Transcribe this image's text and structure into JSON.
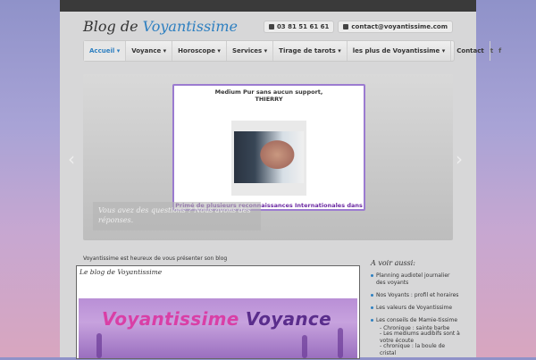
{
  "header": {
    "title_plain": "Blog de ",
    "title_accent": "Voyantissime",
    "phone": "03 81 51 61 61",
    "email": "contact@voyantissime.com"
  },
  "nav": {
    "items": [
      {
        "label": "Accueil",
        "caret": "▾"
      },
      {
        "label": "Voyance",
        "caret": "▾"
      },
      {
        "label": "Horoscope",
        "caret": "▾"
      },
      {
        "label": "Services",
        "caret": "▾"
      },
      {
        "label": "Tirage de tarots",
        "caret": "▾"
      },
      {
        "label": "les plus de Voyantissime",
        "caret": "▾"
      },
      {
        "label": "Contact",
        "caret": ""
      }
    ],
    "social": [
      "twitter-icon",
      "facebook-icon"
    ]
  },
  "slider": {
    "popup_line1": "Medium Pur sans aucun support,",
    "popup_line2": "THIERRY",
    "popup_prize": "Primé de plusieurs reconnaissances Internationales dans le domaine",
    "caption": "Vous avez des questions ? Nous avons des réponses."
  },
  "content": {
    "intro": "Voyantissime est heureux de vous présenter son blog",
    "blog_label": "Le blog de Voyantissime",
    "banner_a": "Voyantissime",
    "banner_b": "Voyance"
  },
  "sidebar": {
    "title": "A voir aussi:",
    "items": [
      {
        "label": "Planning audiotel journalier des voyants"
      },
      {
        "label": "Nos Voyants : profil et horaires"
      },
      {
        "label": "Les valeurs de Voyantissime"
      },
      {
        "label": "Les conseils de Mamie-tissime"
      }
    ],
    "sub_items": [
      "- Chronique : sainte barbe",
      "- Les mediums audibifs sont à votre écoute",
      "- chronique : la boule de cristal"
    ]
  }
}
